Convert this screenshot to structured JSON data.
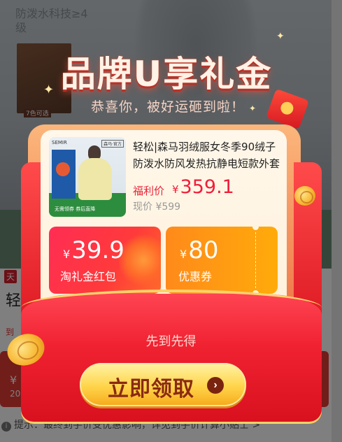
{
  "background": {
    "hero_text": "防泼水科技≥4级",
    "thumb_label": "7色可选",
    "store_tag": "天",
    "title_fragment": "轻",
    "title_dots": "...",
    "red_fragment": "到",
    "buy_price": "¥",
    "buy_sub": "20",
    "hint_icon": "i",
    "hint_text": "提示：最终到手价受优惠影响，详见到手价计算小贴士 >"
  },
  "popup": {
    "title": "品牌U享礼金",
    "subtitle": "恭喜你，被好运砸到啦！",
    "product": {
      "image_brand": "SEMIR",
      "image_badge": "森马·官方",
      "image_footer": "无需领券 券后直降",
      "name": "轻松|森马羽绒服女冬季90绒子防泼水防风发热抗静电短款外套",
      "promo_label": "福利价",
      "promo_currency": "¥",
      "promo_price": "359.1",
      "current_price": "现价 ¥599"
    },
    "coupons": [
      {
        "currency": "¥",
        "amount": "39.9",
        "description": "淘礼金红包"
      },
      {
        "currency": "¥",
        "amount": "80",
        "description": "优惠券"
      }
    ],
    "first_come_text": "先到先得",
    "claim_button_label": "立即领取",
    "claim_button_arrow": "›"
  },
  "colors": {
    "promo_price": "#f01e3a",
    "envelope_red": "#f02232",
    "button_gold": "#ffd44a",
    "coupon_red": "#ff2d54",
    "coupon_orange": "#ffab0a"
  },
  "icons": [
    "info-circle-icon",
    "sparkle-icon",
    "coin-icon",
    "red-envelope-icon",
    "chevron-right-icon"
  ]
}
